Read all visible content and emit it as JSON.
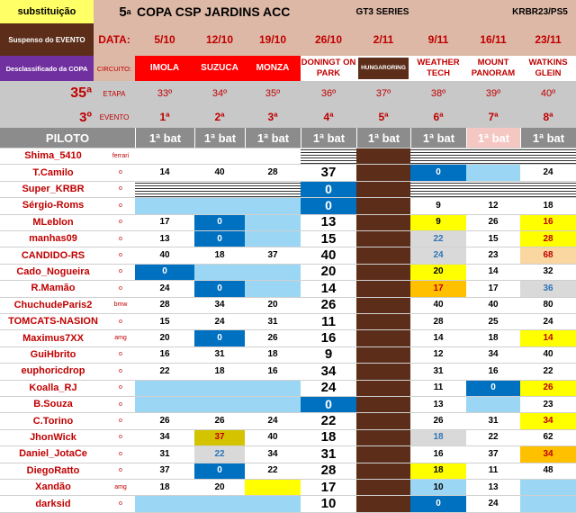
{
  "header": {
    "substitution_label": "substituição",
    "title_num": "5",
    "title_sup": "a",
    "title": "COPA CSP JARDINS ACC",
    "series": "GT3 SERIES",
    "platform": "KRBR23/PS5"
  },
  "legend": {
    "suspended": "Suspenso do EVENTO",
    "disqualified": "Desclassificado da COPA"
  },
  "labels": {
    "data": "DATA:",
    "circuito": "CIRCUITO:",
    "etapa_num": "35ª",
    "etapa": "ETAPA",
    "evento_num": "3º",
    "evento": "EVENTO",
    "piloto": "PILOTO"
  },
  "rounds": [
    {
      "date": "5/10",
      "circuit": "IMOLA",
      "etapa": "33º",
      "evento": "1ª",
      "bat": "1ª bat"
    },
    {
      "date": "12/10",
      "circuit": "SUZUCA",
      "etapa": "34º",
      "evento": "2ª",
      "bat": "1ª bat"
    },
    {
      "date": "19/10",
      "circuit": "MONZA",
      "etapa": "35º",
      "evento": "3ª",
      "bat": "1ª bat"
    },
    {
      "date": "26/10",
      "circuit": "DONINGT ON PARK",
      "etapa": "36º",
      "evento": "4ª",
      "bat": "1ª bat"
    },
    {
      "date": "2/11",
      "circuit": "HUNGARORING",
      "etapa": "37º",
      "evento": "5ª",
      "bat": "1ª bat"
    },
    {
      "date": "9/11",
      "circuit": "WEATHER TECH",
      "etapa": "38º",
      "evento": "6ª",
      "bat": "1ª bat"
    },
    {
      "date": "16/11",
      "circuit": "MOUNT PANORAM",
      "etapa": "39º",
      "evento": "7ª",
      "bat": "1ª bat"
    },
    {
      "date": "23/11",
      "circuit": "WATKINS GLEIN",
      "etapa": "40º",
      "evento": "8ª",
      "bat": "1ª bat"
    }
  ],
  "colors": {
    "blue": "#0070c0",
    "lightblue": "#9bd7f5",
    "yellow": "#ffff00",
    "orange": "#ffc000",
    "peach": "#fad7a0",
    "lightgray": "#d9d9d9",
    "brown": "#5c2e1a",
    "header": "#ddb8a6"
  },
  "drivers": [
    {
      "name": "Shima_5410",
      "car": "ferrari",
      "cells": [
        [
          "",
          ""
        ],
        [
          "",
          ""
        ],
        [
          "",
          ""
        ],
        [
          "",
          "h"
        ],
        [
          "",
          ""
        ],
        [
          "",
          "h"
        ],
        [
          "",
          "h"
        ],
        [
          "",
          "h"
        ]
      ]
    },
    {
      "name": "T.Camilo",
      "car": "o",
      "cells": [
        [
          "14",
          ""
        ],
        [
          "40",
          ""
        ],
        [
          "28",
          ""
        ],
        [
          "37",
          ""
        ],
        [
          "",
          ""
        ],
        [
          "0",
          "blue"
        ],
        [
          "",
          "lightblue"
        ],
        [
          "24",
          ""
        ]
      ]
    },
    {
      "name": "Super_KRBR",
      "car": "o",
      "cells": [
        [
          "",
          "h"
        ],
        [
          "",
          "h"
        ],
        [
          "",
          "h"
        ],
        [
          "0",
          "blue"
        ],
        [
          "",
          ""
        ],
        [
          "",
          "h"
        ],
        [
          "",
          "h"
        ],
        [
          "",
          "h"
        ]
      ]
    },
    {
      "name": "Sérgio-Roms",
      "car": "o",
      "cells": [
        [
          "",
          "lightblue"
        ],
        [
          "",
          "lightblue"
        ],
        [
          "",
          "lightblue"
        ],
        [
          "0",
          "blue"
        ],
        [
          "",
          ""
        ],
        [
          "9",
          ""
        ],
        [
          "12",
          ""
        ],
        [
          "18",
          ""
        ]
      ]
    },
    {
      "name": "MLeblon",
      "car": "o",
      "cells": [
        [
          "17",
          ""
        ],
        [
          "0",
          "blue"
        ],
        [
          "",
          "lightblue"
        ],
        [
          "13",
          ""
        ],
        [
          "",
          ""
        ],
        [
          "9",
          "yellow"
        ],
        [
          "26",
          ""
        ],
        [
          "16",
          "yellow"
        ]
      ]
    },
    {
      "name": "manhas09",
      "car": "o",
      "cells": [
        [
          "13",
          ""
        ],
        [
          "0",
          "blue"
        ],
        [
          "",
          "lightblue"
        ],
        [
          "15",
          ""
        ],
        [
          "",
          ""
        ],
        [
          "22",
          "lightgray"
        ],
        [
          "15",
          ""
        ],
        [
          "28",
          "yellow"
        ]
      ]
    },
    {
      "name": "CANDIDO-RS",
      "car": "o",
      "cells": [
        [
          "40",
          ""
        ],
        [
          "18",
          ""
        ],
        [
          "37",
          ""
        ],
        [
          "40",
          ""
        ],
        [
          "",
          ""
        ],
        [
          "24",
          "lightgray"
        ],
        [
          "23",
          ""
        ],
        [
          "68",
          "peach"
        ]
      ]
    },
    {
      "name": "Cado_Nogueira",
      "car": "o",
      "cells": [
        [
          "0",
          "blue"
        ],
        [
          "",
          "lightblue"
        ],
        [
          "",
          "lightblue"
        ],
        [
          "20",
          ""
        ],
        [
          "",
          ""
        ],
        [
          "20",
          "yellow"
        ],
        [
          "14",
          ""
        ],
        [
          "32",
          ""
        ]
      ]
    },
    {
      "name": "R.Mamão",
      "car": "o",
      "cells": [
        [
          "24",
          ""
        ],
        [
          "0",
          "blue"
        ],
        [
          "",
          "lightblue"
        ],
        [
          "14",
          ""
        ],
        [
          "",
          ""
        ],
        [
          "17",
          "orange"
        ],
        [
          "17",
          ""
        ],
        [
          "36",
          "lightgray"
        ]
      ]
    },
    {
      "name": "ChuchudeParis2",
      "car": "bmw",
      "cells": [
        [
          "28",
          ""
        ],
        [
          "34",
          ""
        ],
        [
          "20",
          ""
        ],
        [
          "26",
          ""
        ],
        [
          "",
          ""
        ],
        [
          "40",
          ""
        ],
        [
          "40",
          ""
        ],
        [
          "80",
          ""
        ]
      ]
    },
    {
      "name": "TOMCATS-NASION",
      "car": "o",
      "cells": [
        [
          "15",
          ""
        ],
        [
          "24",
          ""
        ],
        [
          "31",
          ""
        ],
        [
          "11",
          ""
        ],
        [
          "",
          ""
        ],
        [
          "28",
          ""
        ],
        [
          "25",
          ""
        ],
        [
          "24",
          ""
        ]
      ]
    },
    {
      "name": "Maximus7XX",
      "car": "amg",
      "cells": [
        [
          "20",
          ""
        ],
        [
          "0",
          "blue"
        ],
        [
          "26",
          ""
        ],
        [
          "16",
          ""
        ],
        [
          "",
          ""
        ],
        [
          "14",
          ""
        ],
        [
          "18",
          ""
        ],
        [
          "14",
          "yellow"
        ]
      ]
    },
    {
      "name": "GuiHbrito",
      "car": "o",
      "cells": [
        [
          "16",
          ""
        ],
        [
          "31",
          ""
        ],
        [
          "18",
          ""
        ],
        [
          "9",
          ""
        ],
        [
          "",
          ""
        ],
        [
          "12",
          ""
        ],
        [
          "34",
          ""
        ],
        [
          "40",
          ""
        ]
      ]
    },
    {
      "name": "euphoricdrop",
      "car": "o",
      "cells": [
        [
          "22",
          ""
        ],
        [
          "18",
          ""
        ],
        [
          "16",
          ""
        ],
        [
          "34",
          ""
        ],
        [
          "",
          ""
        ],
        [
          "31",
          ""
        ],
        [
          "16",
          ""
        ],
        [
          "22",
          ""
        ]
      ]
    },
    {
      "name": "Koalla_RJ",
      "car": "o",
      "cells": [
        [
          "",
          "lightblue"
        ],
        [
          "",
          "lightblue"
        ],
        [
          "",
          "lightblue"
        ],
        [
          "24",
          ""
        ],
        [
          "",
          ""
        ],
        [
          "11",
          ""
        ],
        [
          "0",
          "blue"
        ],
        [
          "26",
          "yellow"
        ]
      ]
    },
    {
      "name": "B.Souza",
      "car": "o",
      "cells": [
        [
          "",
          "lightblue"
        ],
        [
          "",
          "lightblue"
        ],
        [
          "",
          "lightblue"
        ],
        [
          "0",
          "blue"
        ],
        [
          "",
          ""
        ],
        [
          "13",
          ""
        ],
        [
          "",
          "lightblue"
        ],
        [
          "23",
          ""
        ]
      ]
    },
    {
      "name": "C.Torino",
      "car": "o",
      "cells": [
        [
          "26",
          ""
        ],
        [
          "26",
          ""
        ],
        [
          "24",
          ""
        ],
        [
          "22",
          ""
        ],
        [
          "",
          ""
        ],
        [
          "26",
          ""
        ],
        [
          "31",
          ""
        ],
        [
          "34",
          "yellow"
        ]
      ]
    },
    {
      "name": "JhonWick",
      "car": "o",
      "cells": [
        [
          "34",
          ""
        ],
        [
          "37",
          "olive"
        ],
        [
          "40",
          ""
        ],
        [
          "18",
          ""
        ],
        [
          "",
          ""
        ],
        [
          "18",
          "lightgray"
        ],
        [
          "22",
          ""
        ],
        [
          "62",
          ""
        ]
      ]
    },
    {
      "name": "Daniel_JotaCe",
      "car": "o",
      "cells": [
        [
          "31",
          ""
        ],
        [
          "22",
          "lightgray"
        ],
        [
          "34",
          ""
        ],
        [
          "31",
          ""
        ],
        [
          "",
          ""
        ],
        [
          "16",
          ""
        ],
        [
          "37",
          ""
        ],
        [
          "34",
          "orange"
        ]
      ]
    },
    {
      "name": "DiegoRatto",
      "car": "o",
      "cells": [
        [
          "37",
          ""
        ],
        [
          "0",
          "blue"
        ],
        [
          "22",
          ""
        ],
        [
          "28",
          ""
        ],
        [
          "",
          ""
        ],
        [
          "18",
          "yellow"
        ],
        [
          "11",
          ""
        ],
        [
          "48",
          ""
        ]
      ]
    },
    {
      "name": "Xandão",
      "car": "amg",
      "cells": [
        [
          "18",
          ""
        ],
        [
          "20",
          ""
        ],
        [
          "",
          "yellow"
        ],
        [
          "17",
          ""
        ],
        [
          "",
          ""
        ],
        [
          "10",
          "lightblue"
        ],
        [
          "13",
          ""
        ],
        [
          "",
          "lightblue"
        ]
      ]
    },
    {
      "name": "darksid",
      "car": "o",
      "cells": [
        [
          "",
          "lightblue"
        ],
        [
          "",
          "lightblue"
        ],
        [
          "",
          "lightblue"
        ],
        [
          "10",
          ""
        ],
        [
          "",
          ""
        ],
        [
          "0",
          "blue"
        ],
        [
          "24",
          ""
        ],
        [
          "",
          "lightblue"
        ]
      ]
    }
  ]
}
